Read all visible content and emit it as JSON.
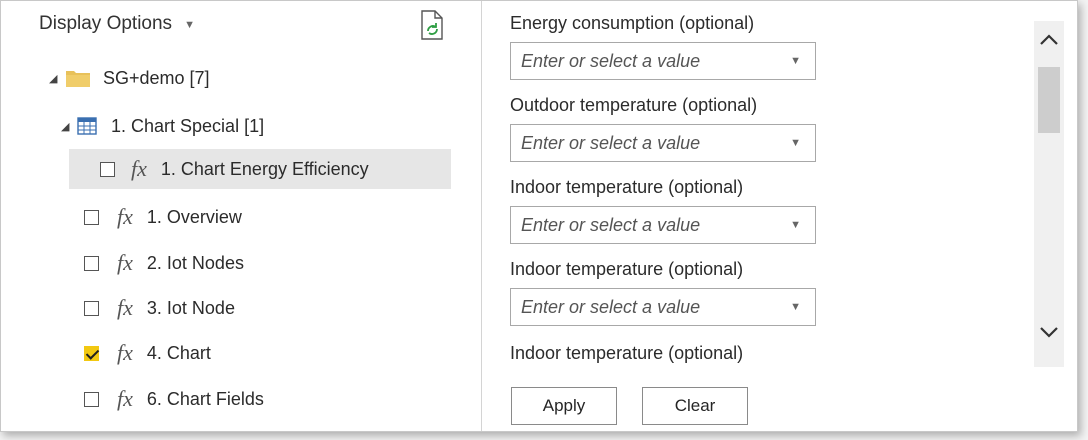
{
  "left_pane": {
    "display_options_label": "Display Options",
    "tree": {
      "root": {
        "label": "SG+demo [7]",
        "icon": "folder-icon",
        "expanded": true
      },
      "group": {
        "label": "1. Chart Special [1]",
        "icon": "table-icon",
        "expanded": true
      },
      "items": [
        {
          "label": "1. Chart Energy Efficiency",
          "checked": false,
          "selected": true
        },
        {
          "label": "1. Overview",
          "checked": false
        },
        {
          "label": "2. Iot Nodes",
          "checked": false
        },
        {
          "label": "3. Iot Node",
          "checked": false
        },
        {
          "label": "4. Chart",
          "checked": true
        },
        {
          "label": "6. Chart Fields",
          "checked": false
        }
      ],
      "fx_symbol": "fx"
    }
  },
  "right_pane": {
    "parameters": [
      {
        "label": "Energy consumption (optional)",
        "placeholder": "Enter or select a value"
      },
      {
        "label": "Outdoor temperature (optional)",
        "placeholder": "Enter or select a value"
      },
      {
        "label": "Indoor temperature (optional)",
        "placeholder": "Enter or select a value"
      },
      {
        "label": "Indoor temperature (optional)",
        "placeholder": "Enter or select a value"
      },
      {
        "label": "Indoor temperature (optional)"
      }
    ],
    "apply_label": "Apply",
    "clear_label": "Clear"
  },
  "colors": {
    "checked": "#f2c811",
    "selected_row": "#e6e6e6",
    "folder": "#e8c15a"
  }
}
